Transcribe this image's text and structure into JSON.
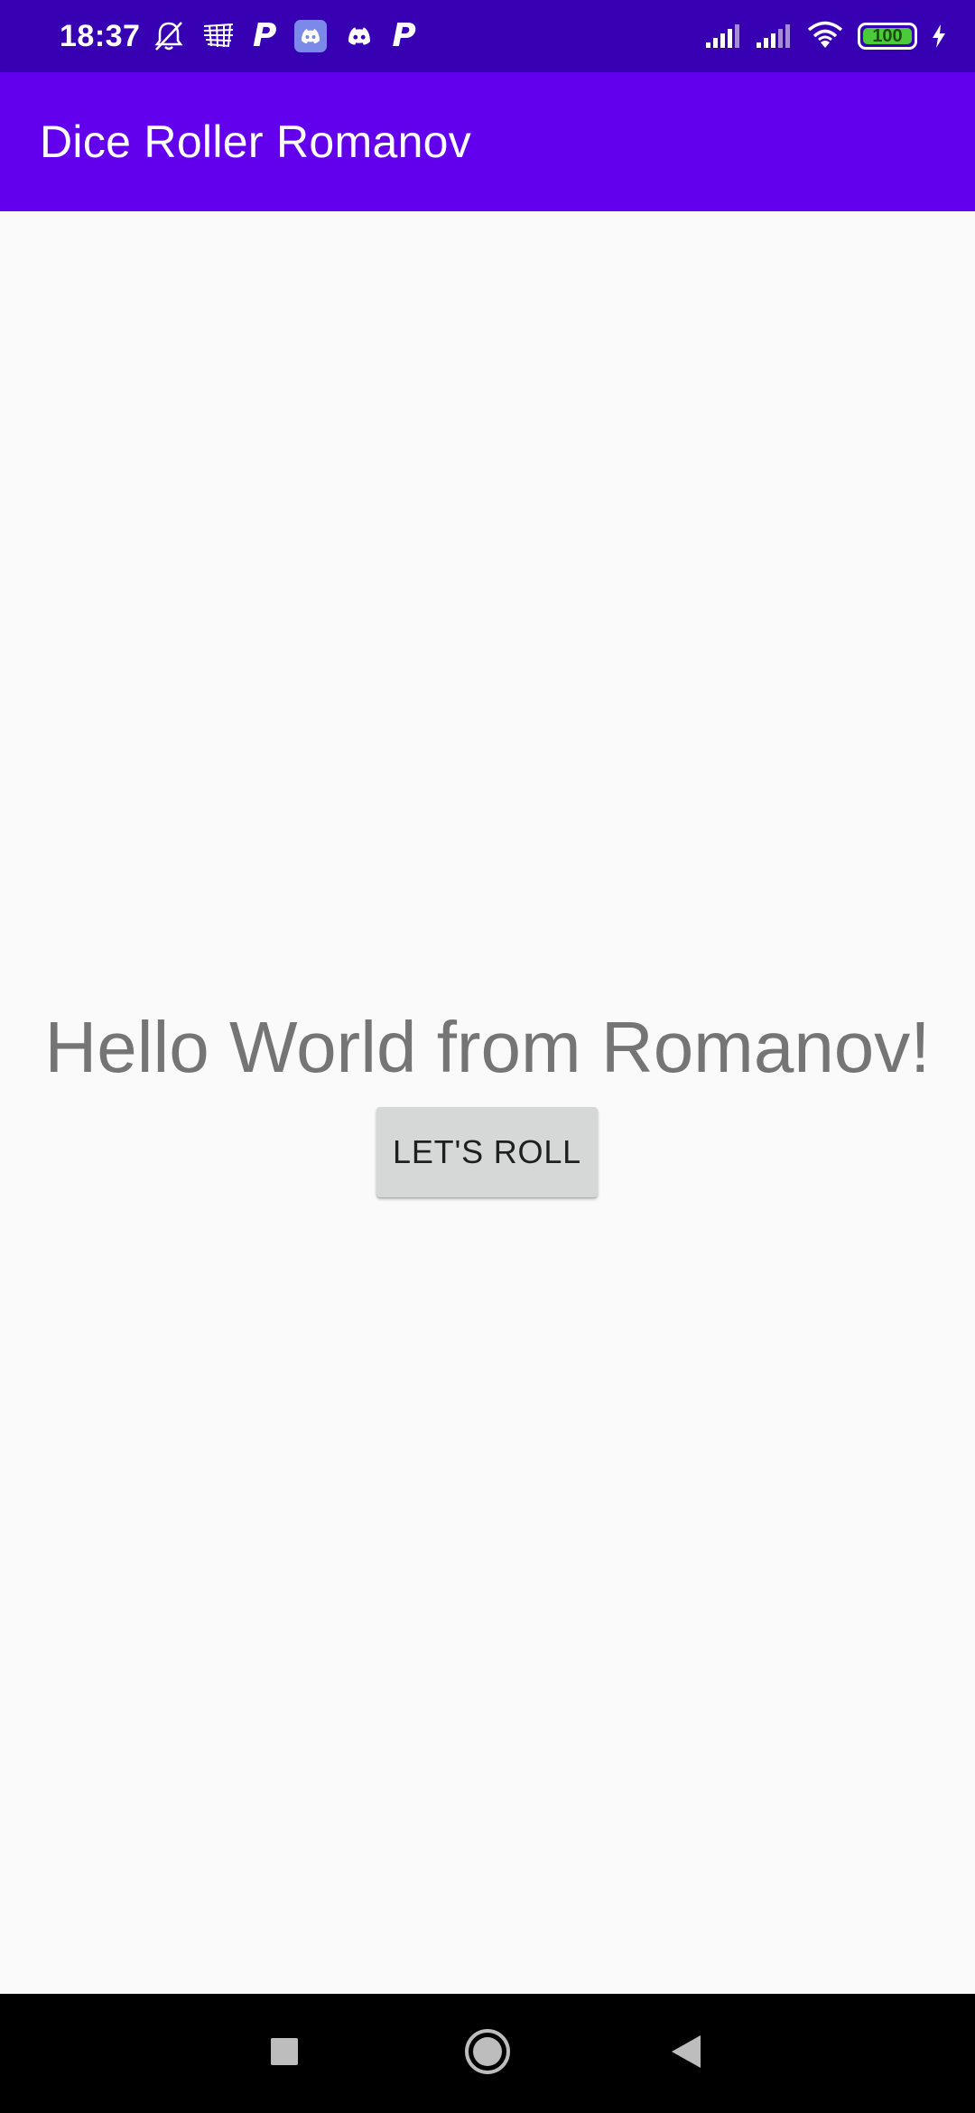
{
  "status_bar": {
    "time": "18:37",
    "left_icons": [
      "bell-muted-icon",
      "network-speed-icon",
      "p-app-icon",
      "discord-app-icon",
      "discord-icon",
      "p-app-icon"
    ],
    "battery_level": "100",
    "battery_color": "#4CCB3A",
    "background": "#3700B3"
  },
  "app_bar": {
    "title": "Dice Roller Romanov",
    "background": "#6200EE"
  },
  "main": {
    "greeting": "Hello World from Romanov!",
    "roll_button_label": "LET'S ROLL"
  },
  "nav_bar": {
    "buttons": [
      "recents-square-icon",
      "home-circle-icon",
      "back-triangle-icon"
    ]
  }
}
